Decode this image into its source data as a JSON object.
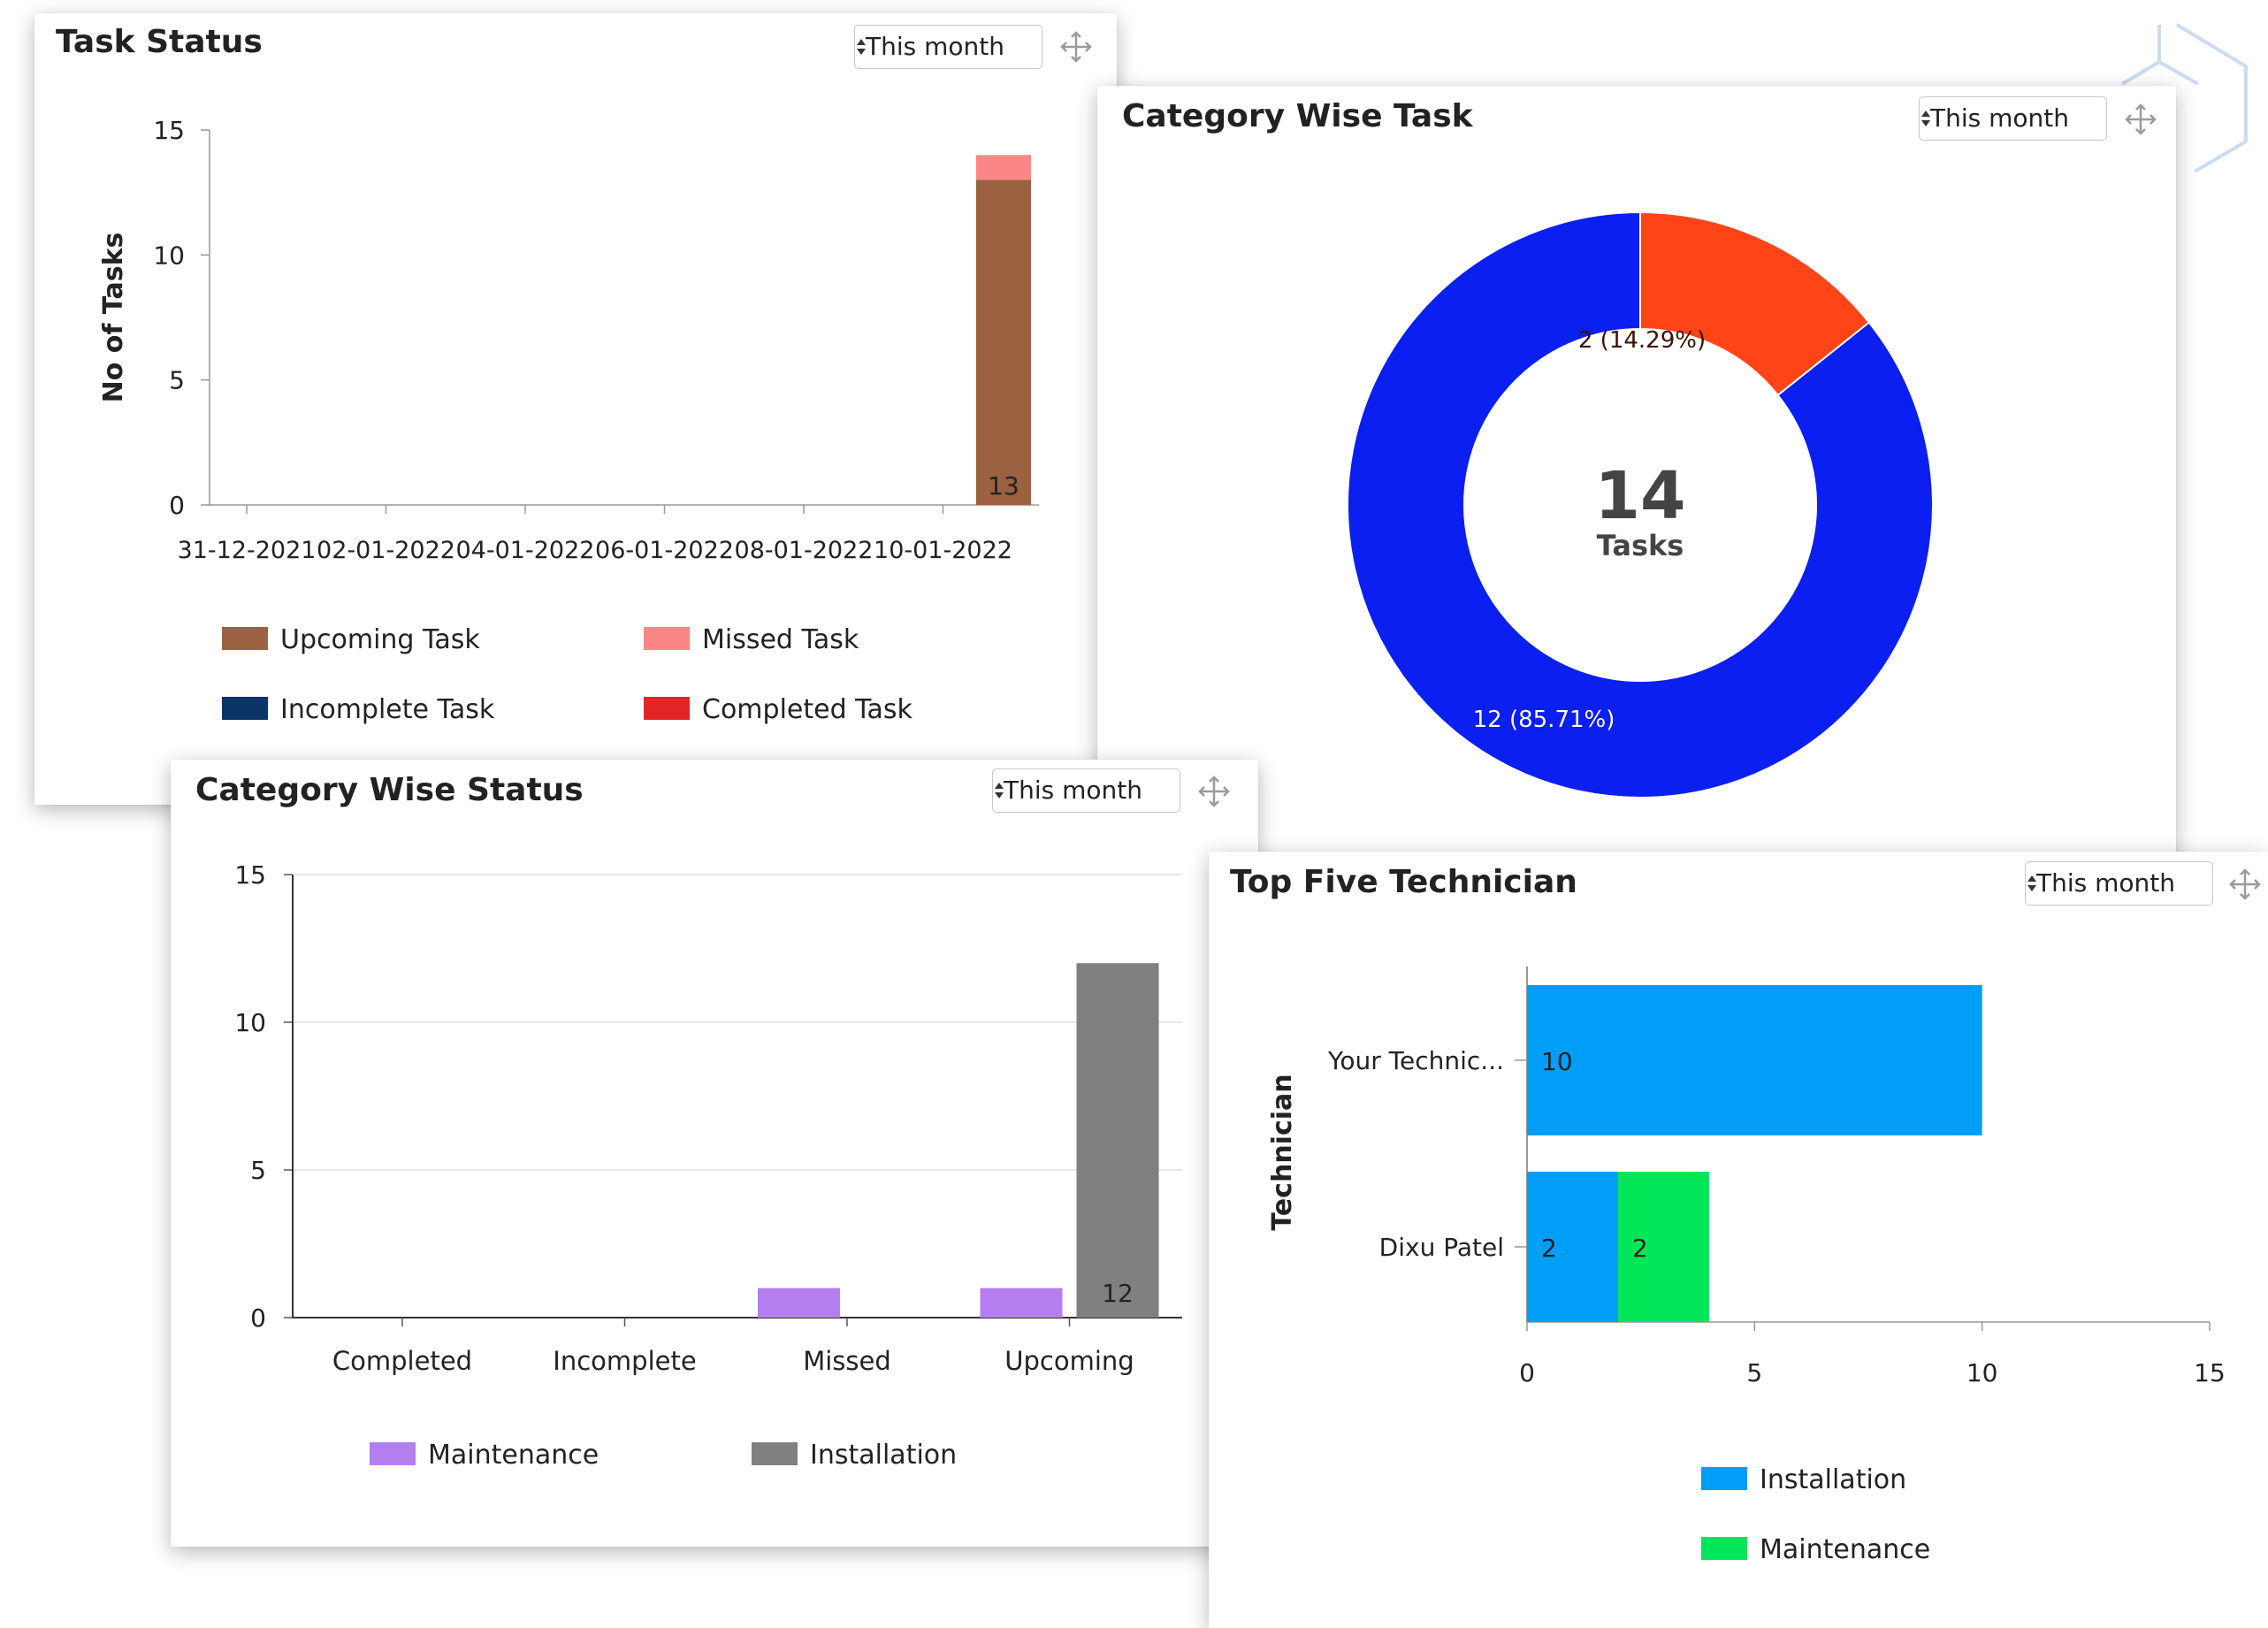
{
  "period_label": "This month",
  "charts": [
    {
      "title": "Task Status",
      "type": "bar",
      "stacked": true,
      "ylabel": "No of Tasks",
      "ylim": [
        0,
        15
      ],
      "yticks": [
        "0",
        "5",
        "10",
        "15"
      ],
      "categories": [
        "31-12-2021",
        "02-01-2022",
        "04-01-2022",
        "06-01-2022",
        "08-01-2022",
        "10-01-2022"
      ],
      "data_labels": [
        "13"
      ],
      "series": [
        {
          "name": "Upcoming Task",
          "color": "#9b6140",
          "points": [
            {
              "x": "10-01-2022",
              "y": 13
            }
          ]
        },
        {
          "name": "Missed Task",
          "color": "#fb8686",
          "points": [
            {
              "x": "10-01-2022",
              "y": 1
            }
          ]
        },
        {
          "name": "Incomplete Task",
          "color": "#0b3566",
          "points": []
        },
        {
          "name": "Completed Task",
          "color": "#e32525",
          "points": []
        }
      ]
    },
    {
      "title": "Category Wise Task",
      "type": "pie",
      "center_value": "14",
      "center_label": "Tasks",
      "slices": [
        {
          "value": 2,
          "percent": 14.29,
          "label": "2 (14.29%)",
          "color": "#ff4517"
        },
        {
          "value": 12,
          "percent": 85.71,
          "label": "12 (85.71%)",
          "color": "#0a1ff0"
        }
      ]
    },
    {
      "title": "Category Wise Status",
      "type": "bar",
      "ylim": [
        0,
        15
      ],
      "yticks": [
        "0",
        "5",
        "10",
        "15"
      ],
      "categories": [
        "Completed",
        "Incomplete",
        "Missed",
        "Upcoming"
      ],
      "grid": true,
      "data_labels": [
        "12"
      ],
      "series": [
        {
          "name": "Maintenance",
          "color": "#b57ef0",
          "values": [
            0,
            0,
            1,
            1
          ]
        },
        {
          "name": "Installation",
          "color": "#808080",
          "values": [
            0,
            0,
            0,
            12
          ]
        }
      ]
    },
    {
      "title": "Top Five Technician",
      "type": "bar",
      "orientation": "horizontal",
      "stacked": true,
      "ylabel": "Technician",
      "xlim": [
        0,
        15
      ],
      "xticks": [
        "0",
        "5",
        "10",
        "15"
      ],
      "categories": [
        "Your Technic...",
        "Dixu Patel"
      ],
      "series": [
        {
          "name": "Installation",
          "color": "#009ef7",
          "values": [
            10,
            2
          ],
          "labels": [
            "10",
            "2"
          ]
        },
        {
          "name": "Maintenance",
          "color": "#00e658",
          "values": [
            0,
            2
          ],
          "labels": [
            "",
            "2"
          ]
        }
      ]
    }
  ]
}
